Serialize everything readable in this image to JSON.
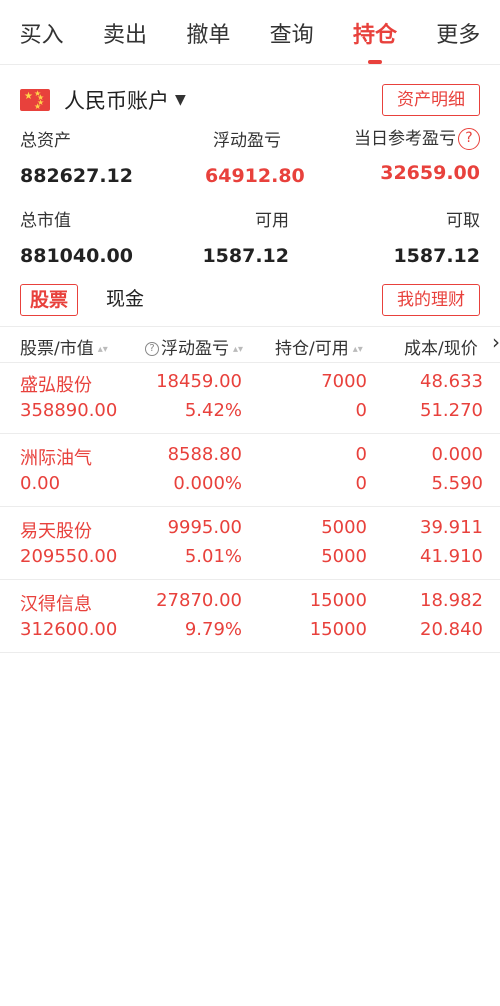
{
  "tabs": [
    {
      "label": "买入"
    },
    {
      "label": "卖出"
    },
    {
      "label": "撤单"
    },
    {
      "label": "查询"
    },
    {
      "label": "持仓"
    },
    {
      "label": "更多"
    }
  ],
  "active_tab": "持仓",
  "account": {
    "flag_icon": "cn-flag-icon",
    "name": "人民币账户",
    "caret": "▼",
    "detail_button": "资产明细"
  },
  "summary": {
    "total_assets_label": "总资产",
    "total_assets": "882627.12",
    "floating_pl_label": "浮动盈亏",
    "floating_pl": "64912.80",
    "daily_pl_label": "当日参考盈亏",
    "daily_pl": "32659.00",
    "market_value_label": "总市值",
    "market_value": "881040.00",
    "available_label": "可用",
    "available": "1587.12",
    "withdrawable_label": "可取",
    "withdrawable": "1587.12"
  },
  "subtabs": {
    "stocks": "股票",
    "cash": "现金",
    "wealth_button": "我的理财"
  },
  "table": {
    "headers": [
      "股票/市值",
      "浮动盈亏",
      "持仓/可用",
      "成本/现价"
    ],
    "rows": [
      {
        "name": "盛弘股份",
        "market_value": "358890.00",
        "pl": "18459.00",
        "pl_pct": "5.42%",
        "position": "7000",
        "available": "0",
        "cost": "48.633",
        "price": "51.270"
      },
      {
        "name": "洲际油气",
        "market_value": "0.00",
        "pl": "8588.80",
        "pl_pct": "0.000%",
        "position": "0",
        "available": "0",
        "cost": "0.000",
        "price": "5.590"
      },
      {
        "name": "易天股份",
        "market_value": "209550.00",
        "pl": "9995.00",
        "pl_pct": "5.01%",
        "position": "5000",
        "available": "5000",
        "cost": "39.911",
        "price": "41.910"
      },
      {
        "name": "汉得信息",
        "market_value": "312600.00",
        "pl": "27870.00",
        "pl_pct": "9.79%",
        "position": "15000",
        "available": "15000",
        "cost": "18.982",
        "price": "20.840"
      }
    ]
  },
  "colors": {
    "accent": "#e8413c",
    "text": "#222222",
    "divider": "#ececec"
  }
}
